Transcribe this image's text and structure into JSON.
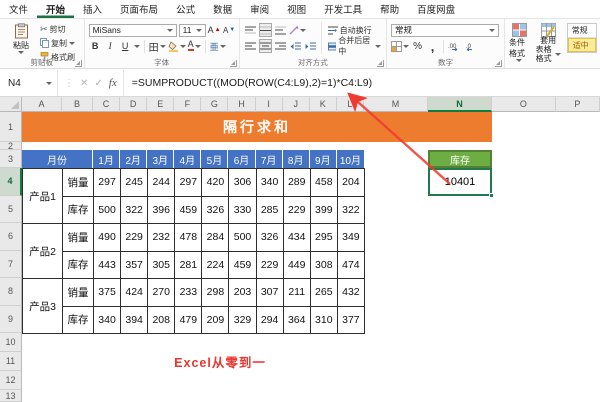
{
  "app": {
    "tabs": [
      "文件",
      "开始",
      "插入",
      "页面布局",
      "公式",
      "数据",
      "审阅",
      "视图",
      "开发工具",
      "帮助",
      "百度网盘"
    ],
    "active_tab": "开始"
  },
  "ribbon": {
    "clipboard": {
      "group_label": "剪贴板",
      "paste": "粘贴",
      "cut": "剪切",
      "copy": "复制",
      "format_painter": "格式刷"
    },
    "font": {
      "group_label": "字体",
      "font_name": "MiSans",
      "font_size": "11",
      "bold": "B",
      "italic": "I",
      "underline": "U",
      "borders_glyph": "田",
      "phonetic_glyph": "亜",
      "grow": "A",
      "shrink": "A"
    },
    "alignment": {
      "group_label": "对齐方式",
      "wrap_text": "自动换行",
      "merge_center": "合并后居中"
    },
    "number": {
      "group_label": "数字",
      "format": "常规",
      "percent": "%",
      "comma": ","
    },
    "styles": {
      "conditional": "条件格式",
      "format_table_line1": "套用",
      "format_table_line2": "表格格式",
      "style_normal": "常规",
      "style_neutral": "适中"
    }
  },
  "formula_bar": {
    "name_box": "N4",
    "cancel_glyph": "✕",
    "enter_glyph": "✓",
    "fx_glyph": "fx",
    "formula": "=SUMPRODUCT((MOD(ROW(C4:L9),2)=1)*C4:L9)"
  },
  "sheet": {
    "column_headers": [
      "A",
      "B",
      "C",
      "D",
      "E",
      "F",
      "G",
      "H",
      "I",
      "J",
      "K",
      "L",
      "M",
      "N",
      "O",
      "P"
    ],
    "selected_column": "N",
    "row_headers": [
      "1",
      "2",
      "3",
      "4",
      "5",
      "6",
      "7",
      "8",
      "9",
      "10",
      "11",
      "12",
      "13"
    ],
    "selected_row": "4",
    "title_banner": "隔行求和",
    "month_header": {
      "label": "月份",
      "months": [
        "1月",
        "2月",
        "3月",
        "4月",
        "5月",
        "6月",
        "7月",
        "8月",
        "9月",
        "10月"
      ]
    },
    "products": [
      {
        "name": "产品1",
        "rows": [
          {
            "label": "销量",
            "values": [
              297,
              245,
              244,
              297,
              420,
              306,
              340,
              289,
              458,
              204
            ]
          },
          {
            "label": "库存",
            "values": [
              500,
              322,
              396,
              459,
              326,
              330,
              285,
              229,
              399,
              322
            ]
          }
        ]
      },
      {
        "name": "产品2",
        "rows": [
          {
            "label": "销量",
            "values": [
              490,
              229,
              232,
              478,
              284,
              500,
              326,
              434,
              295,
              349
            ]
          },
          {
            "label": "库存",
            "values": [
              443,
              357,
              305,
              281,
              224,
              459,
              229,
              449,
              308,
              474
            ]
          }
        ]
      },
      {
        "name": "产品3",
        "rows": [
          {
            "label": "销量",
            "values": [
              375,
              424,
              270,
              233,
              298,
              203,
              307,
              211,
              265,
              432
            ]
          },
          {
            "label": "库存",
            "values": [
              340,
              394,
              208,
              479,
              209,
              329,
              294,
              364,
              310,
              377
            ]
          }
        ]
      }
    ],
    "result": {
      "label": "库存",
      "value": "10401"
    },
    "watermark": "Excel从零到一"
  },
  "colors": {
    "banner_orange": "#ed7c2f",
    "header_blue": "#4472c4",
    "result_green": "#6ead44",
    "selection_green": "#1f7a4d",
    "accent_green": "#107c41",
    "annotation_red": "#f03b30",
    "neutral_style_bg": "#ffeb9c",
    "neutral_style_text": "#9c6500"
  }
}
